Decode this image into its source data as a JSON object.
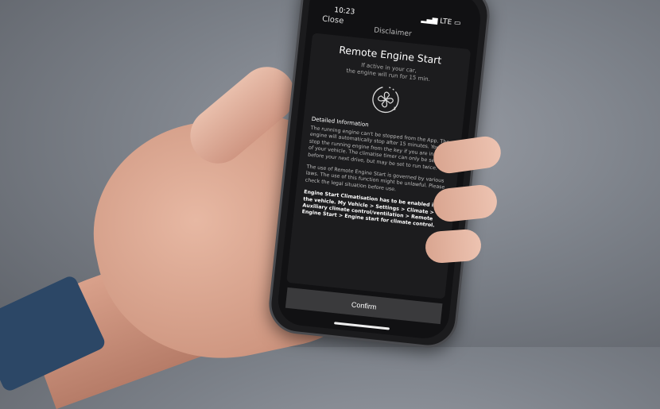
{
  "status_bar": {
    "time": "10:23",
    "network": "LTE"
  },
  "nav": {
    "close_label": "Close",
    "title": "Disclaimer"
  },
  "content": {
    "title": "Remote Engine Start",
    "subtitle_line1": "If active in your car,",
    "subtitle_line2": "the engine will run for 15 min.",
    "icon": "fan-rotate-icon",
    "section_heading": "Detailed Information",
    "paragraph1": "The running engine can't be stopped from the App. The engine will automatically stop after 15 minutes. You can stop the running engine from the key if you are in range of your vehicle. The climatise timer can only be set once before your next drive, but may be set to run twice.",
    "paragraph2": "The use of Remote Engine Start is governed by various laws. The use of this function might be unlawful. Please check the legal situation before use.",
    "paragraph3": "Engine Start Climatisation has to be enabled in the vehicle. My Vehicle > Settings > Climate > Auxiliary climate control/ventilation > Remote Engine Start > Engine start for climate control."
  },
  "confirm_label": "Confirm"
}
